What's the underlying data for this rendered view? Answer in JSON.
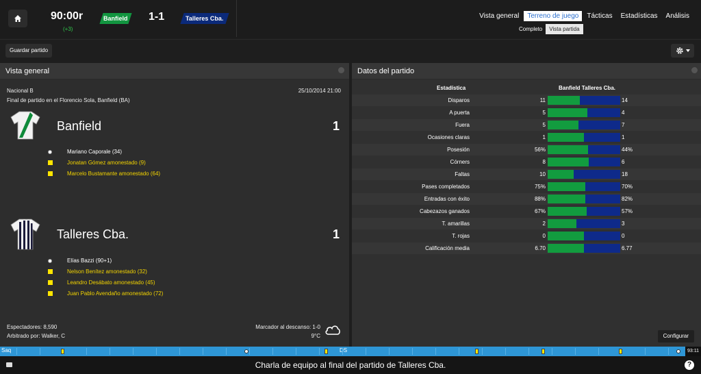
{
  "header": {
    "clock": "90:00r",
    "added_time": "(+3)",
    "home_team": "Banfield",
    "away_team": "Talleres Cba.",
    "score": "1-1",
    "home_color": "#129540",
    "away_color": "#0b2a7a"
  },
  "nav": {
    "tabs": [
      {
        "label": "Vista general",
        "active": false
      },
      {
        "label": "Terreno de juego",
        "active": true
      },
      {
        "label": "Tácticas",
        "active": false
      },
      {
        "label": "Estadísticas",
        "active": false
      },
      {
        "label": "Análisis",
        "active": false
      }
    ],
    "subtabs": [
      {
        "label": "Completo",
        "active": false
      },
      {
        "label": "Vista partida",
        "active": true
      }
    ]
  },
  "toolbar": {
    "save_label": "Guardar partido",
    "settings_icon": "gear-icon"
  },
  "overview": {
    "title": "Vista general",
    "competition": "Nacional B",
    "datetime": "25/10/2014 21:00",
    "description": "Final de partido en el Florencio Sola, Banfield (BA)",
    "home": {
      "name": "Banfield",
      "goals": "1",
      "events": [
        {
          "type": "goal",
          "text": "Mariano Caporale (34)"
        },
        {
          "type": "yellow",
          "text": "Jonatan Gómez amonestado (9)"
        },
        {
          "type": "yellow",
          "text": "Marcelo Bustamante amonestado (64)"
        }
      ]
    },
    "away": {
      "name": "Talleres Cba.",
      "goals": "1",
      "events": [
        {
          "type": "goal",
          "text": "Elías Bazzi (90+1)"
        },
        {
          "type": "yellow",
          "text": "Nelson Benítez amonestado (32)"
        },
        {
          "type": "yellow",
          "text": "Leandro Desábato amonestado (45)"
        },
        {
          "type": "yellow",
          "text": "Juan Pablo Avendaño amonestado (72)"
        }
      ]
    },
    "attendance": "Espectadores: 8,590",
    "referee": "Arbitrado por: Walker, C",
    "halftime": "Marcador al descanso: 1-0",
    "temperature": "9°C",
    "weather_icon": "cloud-icon"
  },
  "stats": {
    "title": "Datos del partido",
    "col_stat": "Estadística",
    "col_teams": "Banfield Talleres Cba.",
    "configure_label": "Configurar",
    "rows": [
      {
        "label": "Disparos",
        "home": "11",
        "away": "14",
        "home_share": 0.44
      },
      {
        "label": "A puerta",
        "home": "5",
        "away": "4",
        "home_share": 0.55
      },
      {
        "label": "Fuera",
        "home": "5",
        "away": "7",
        "home_share": 0.42
      },
      {
        "label": "Ocasiones claras",
        "home": "1",
        "away": "1",
        "home_share": 0.5
      },
      {
        "label": "Posesión",
        "home": "56%",
        "away": "44%",
        "home_share": 0.56
      },
      {
        "label": "Córners",
        "home": "8",
        "away": "6",
        "home_share": 0.57
      },
      {
        "label": "Faltas",
        "home": "10",
        "away": "18",
        "home_share": 0.36
      },
      {
        "label": "Pases completados",
        "home": "75%",
        "away": "70%",
        "home_share": 0.52
      },
      {
        "label": "Entradas con éxito",
        "home": "88%",
        "away": "82%",
        "home_share": 0.52
      },
      {
        "label": "Cabezazos ganados",
        "home": "67%",
        "away": "57%",
        "home_share": 0.54
      },
      {
        "label": "T. amarillas",
        "home": "2",
        "away": "3",
        "home_share": 0.4
      },
      {
        "label": "T. rojas",
        "home": "0",
        "away": "0",
        "home_share": 0.5
      },
      {
        "label": "Calificación media",
        "home": "6.70",
        "away": "6.77",
        "home_share": 0.5
      }
    ]
  },
  "timeline": {
    "start_label": "Saq",
    "half_label": "DS",
    "time": "93:11"
  },
  "footer": {
    "message": "Charla de equipo al final del partido de Talleres Cba.",
    "help_label": "?"
  }
}
